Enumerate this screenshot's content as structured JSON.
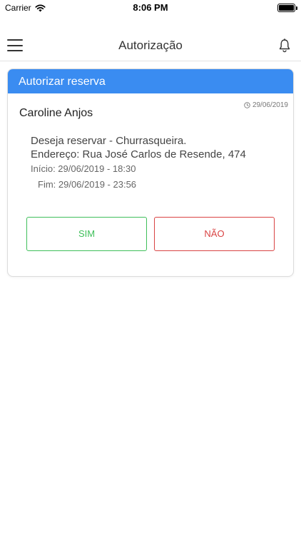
{
  "status_bar": {
    "carrier": "Carrier",
    "time": "8:06 PM"
  },
  "nav": {
    "title": "Autorização",
    "left_icon": "hamburger-menu-icon",
    "right_icon": "bell-icon"
  },
  "card": {
    "header": "Autorizar reserva",
    "header_color": "#3a8cf1",
    "date": "29/06/2019",
    "requester": "Caroline Anjos",
    "request_text": "Deseja reservar - Churrasqueira.",
    "address": "Endereço: Rua José Carlos de Resende, 474",
    "start": "Início: 29/06/2019 - 18:30",
    "end": "Fim: 29/06/2019 - 23:56",
    "yes_label": "SIM",
    "no_label": "NÃO",
    "yes_color": "#3fbf5a",
    "no_color": "#d94343"
  }
}
